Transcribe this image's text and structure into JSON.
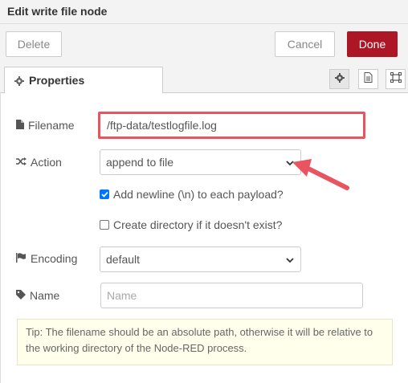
{
  "dialog": {
    "title": "Edit write file node"
  },
  "toolbar": {
    "delete_label": "Delete",
    "cancel_label": "Cancel",
    "done_label": "Done"
  },
  "tabs": {
    "properties_label": "Properties",
    "icons": [
      "gear-icon",
      "description-icon",
      "appearance-icon"
    ]
  },
  "form": {
    "filename": {
      "label": "Filename",
      "value": "/ftp-data/testlogfile.log"
    },
    "action": {
      "label": "Action",
      "selected": "append to file"
    },
    "add_newline": {
      "label": "Add newline (\\n) to each payload?",
      "checked": true
    },
    "create_directory": {
      "label": "Create directory if it doesn't exist?",
      "checked": false
    },
    "encoding": {
      "label": "Encoding",
      "selected": "default"
    },
    "name": {
      "label": "Name",
      "value": "",
      "placeholder": "Name"
    }
  },
  "tip": {
    "text": "Tip: The filename should be an absolute path, otherwise it will be relative to the working directory of the Node-RED process."
  },
  "colors": {
    "done_button": "#ad1625",
    "annotation": "#e8545f",
    "checkbox_checked": "#0075ff",
    "tip_background": "#ffffeb"
  }
}
